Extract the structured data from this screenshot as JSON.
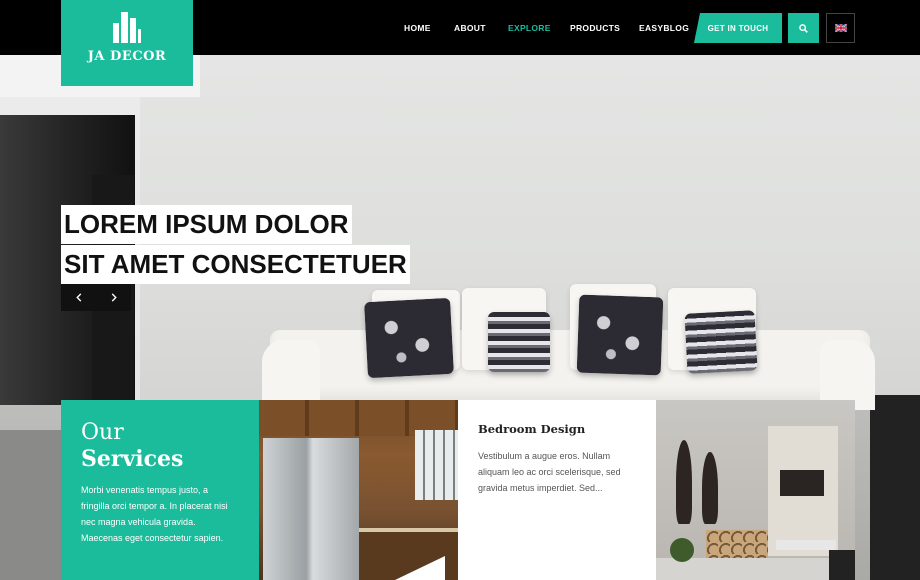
{
  "brand": {
    "name": "JA DECOR",
    "accent": "#1abc9c"
  },
  "nav": {
    "items": [
      {
        "label": "HOME",
        "active": false
      },
      {
        "label": "ABOUT",
        "active": false
      },
      {
        "label": "EXPLORE",
        "active": true
      },
      {
        "label": "PRODUCTS",
        "active": false
      },
      {
        "label": "EASYBLOG",
        "active": false
      }
    ],
    "cta_label": "GET IN TOUCH",
    "search_icon": "search-icon",
    "language_icon": "uk-flag-icon"
  },
  "hero": {
    "line1": "LOREM IPSUM DOLOR",
    "line2": "SIT AMET CONSECTETUER",
    "prev_icon": "chevron-left-icon",
    "next_icon": "chevron-right-icon"
  },
  "services": {
    "title_light": "Our",
    "title_bold": "Services",
    "body": "Morbi venenatis tempus justo, a fringilla orci tempor a. In placerat nisi nec magna vehicula gravida. Maecenas eget consectetur sapien.",
    "card": {
      "title": "Bedroom Design",
      "body": "Vestibulum a augue eros. Nullam aliquam leo ac orci scelerisque, sed gravida metus imperdiet. Sed..."
    }
  }
}
